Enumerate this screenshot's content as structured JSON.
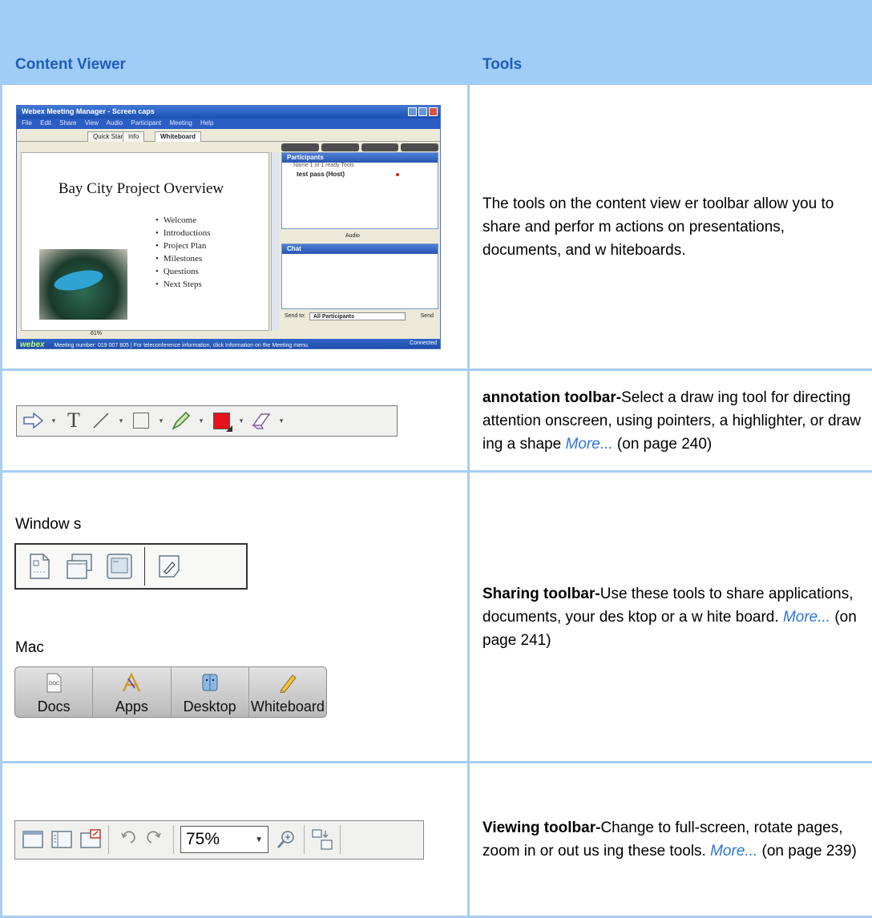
{
  "header": {
    "col1": "Content Viewer",
    "col2": "Tools"
  },
  "rows": [
    {
      "description": "The tools on the content view er toolbar allow you to share and perfor m actions on presentations, documents, and w hiteboards."
    },
    {
      "title": "annotation toolbar-",
      "text": "Select a draw ing tool for directing attention onscreen, using pointers, a highlighter, or draw ing a shape ",
      "more": "More...",
      "page_ref": " (on page 240)"
    },
    {
      "title": "Sharing toolbar-",
      "text": "Use these tools to share applications, documents, your des ktop or a w hite board. ",
      "more": "More...",
      "page_ref": " (on page 241)",
      "windows_label": "Window s",
      "mac_label": "Mac",
      "mac_buttons": [
        "Docs",
        "Apps",
        "Desktop",
        "Whiteboard"
      ]
    },
    {
      "title": "Viewing toolbar-",
      "text": "Change to full-screen, rotate pages, zoom in or out us ing these tools. ",
      "more": "More...",
      "page_ref": " (on page 239)",
      "zoom_value": "75%"
    }
  ],
  "screenshot": {
    "title": "Webex Meeting Manager - Screen caps",
    "menu": "File Edit Share View Audio Participant Meeting Help",
    "tab_active": "Whiteboard",
    "tab_1": "Quick Start",
    "tab_2": "Info",
    "slide_title": "Bay City Project Overview",
    "slide_items": [
      "Welcome",
      "Introductions",
      "Project Plan",
      "Milestones",
      "Questions",
      "Next Steps"
    ],
    "participants_header": "Participants",
    "participants_cols": "Name   1 of 1 ready   Tools",
    "participant": "test pass (Host)",
    "audio_label": "Audio",
    "chat_header": "Chat",
    "send_to": "Send to:",
    "send_to_value": "All Participants",
    "send_button": "Send",
    "zoom": "61%",
    "status_logo": "webex",
    "status_text": "Meeting number: 019 007 805  |  For teleconference information, click Information on the Meeting menu.",
    "status_conn": "Connected"
  },
  "colors": {
    "header_bg": "#9fcdf8",
    "header_text": "#1f5db8",
    "border": "#a9cdef",
    "link": "#2e75d6"
  }
}
